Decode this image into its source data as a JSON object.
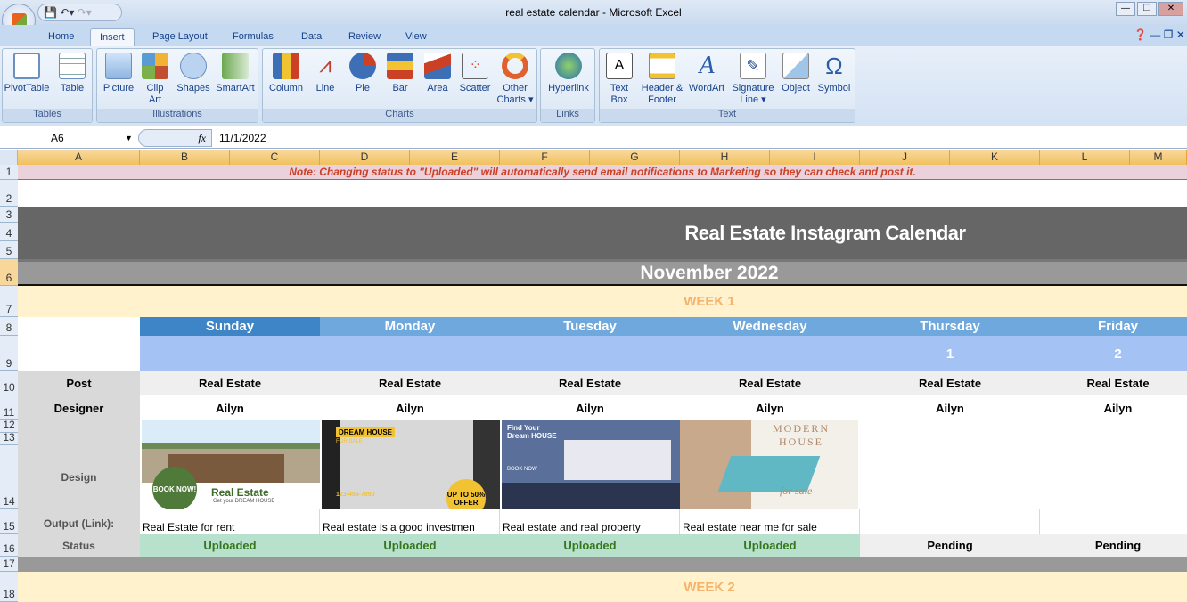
{
  "window": {
    "title": "real estate calendar - Microsoft Excel"
  },
  "tabs": [
    "Home",
    "Insert",
    "Page Layout",
    "Formulas",
    "Data",
    "Review",
    "View"
  ],
  "active_tab": "Insert",
  "ribbon": {
    "groups": [
      {
        "label": "Tables",
        "buttons": [
          "PivotTable",
          "Table"
        ]
      },
      {
        "label": "Illustrations",
        "buttons": [
          "Picture",
          "Clip Art",
          "Shapes",
          "SmartArt"
        ]
      },
      {
        "label": "Charts",
        "buttons": [
          "Column",
          "Line",
          "Pie",
          "Bar",
          "Area",
          "Scatter",
          "Other Charts"
        ]
      },
      {
        "label": "Links",
        "buttons": [
          "Hyperlink"
        ]
      },
      {
        "label": "Text",
        "buttons": [
          "Text Box",
          "Header & Footer",
          "WordArt",
          "Signature Line",
          "Object",
          "Symbol"
        ]
      }
    ]
  },
  "formula_bar": {
    "name_box": "A6",
    "fx": "fx",
    "value": "11/1/2022"
  },
  "columns": [
    "A",
    "B",
    "C",
    "D",
    "E",
    "F",
    "G",
    "H",
    "I",
    "J",
    "K",
    "L",
    "M"
  ],
  "rows": [
    "1",
    "2",
    "3",
    "4",
    "5",
    "6",
    "7",
    "8",
    "9",
    "10",
    "11",
    "12",
    "13",
    "14",
    "15",
    "16",
    "17",
    "18"
  ],
  "sheet": {
    "note": "Note: Changing status to \"Uploaded\" will automatically send email notifications to Marketing so they can check and post it.",
    "title": "Real Estate Instagram Calendar",
    "month": "November 2022",
    "week1": "WEEK 1",
    "week2": "WEEK 2",
    "row_labels": {
      "post": "Post",
      "designer": "Designer",
      "design": "Design",
      "output": "Output (Link):",
      "status": "Status"
    },
    "days": [
      {
        "name": "Sunday",
        "date": "",
        "post": "Real Estate",
        "designer": "Ailyn",
        "output": "Real Estate for rent",
        "status": "Uploaded"
      },
      {
        "name": "Monday",
        "date": "",
        "post": "Real Estate",
        "designer": "Ailyn",
        "output": "Real estate is a good investmen",
        "status": "Uploaded"
      },
      {
        "name": "Tuesday",
        "date": "",
        "post": "Real Estate",
        "designer": "Ailyn",
        "output": "Real estate and real property",
        "status": "Uploaded"
      },
      {
        "name": "Wednesday",
        "date": "",
        "post": "Real Estate",
        "designer": "Ailyn",
        "output": "Real estate near me for sale",
        "status": "Uploaded"
      },
      {
        "name": "Thursday",
        "date": "1",
        "post": "Real Estate",
        "designer": "Ailyn",
        "output": "",
        "status": "Pending"
      },
      {
        "name": "Friday",
        "date": "2",
        "post": "Real Estate",
        "designer": "Ailyn",
        "output": "",
        "status": "Pending"
      }
    ],
    "designs": [
      {
        "headline": "Real Estate",
        "sub": "Get your DREAM HOUSE",
        "badge": "BOOK NOW!"
      },
      {
        "headline": "DREAM HOUSE",
        "sub": "FOR SALE",
        "badge": "UP TO 50% OFFER",
        "phone": "123-456-7890"
      },
      {
        "headline": "Find Your Dream HOUSE",
        "sub": "BOOK NOW"
      },
      {
        "headline": "MODERN HOUSE",
        "sub": "for sale"
      }
    ]
  },
  "colors": {
    "uploaded_bg": "#b7e1cd",
    "uploaded_text": "#38761d",
    "title_bg": "#666666",
    "month_bg": "#999999",
    "week_bg": "#fff2cc",
    "week_text": "#f6b26b",
    "day_header": "#6fa8dc",
    "note_text": "#cc4125",
    "note_bg": "#ead1dc"
  }
}
